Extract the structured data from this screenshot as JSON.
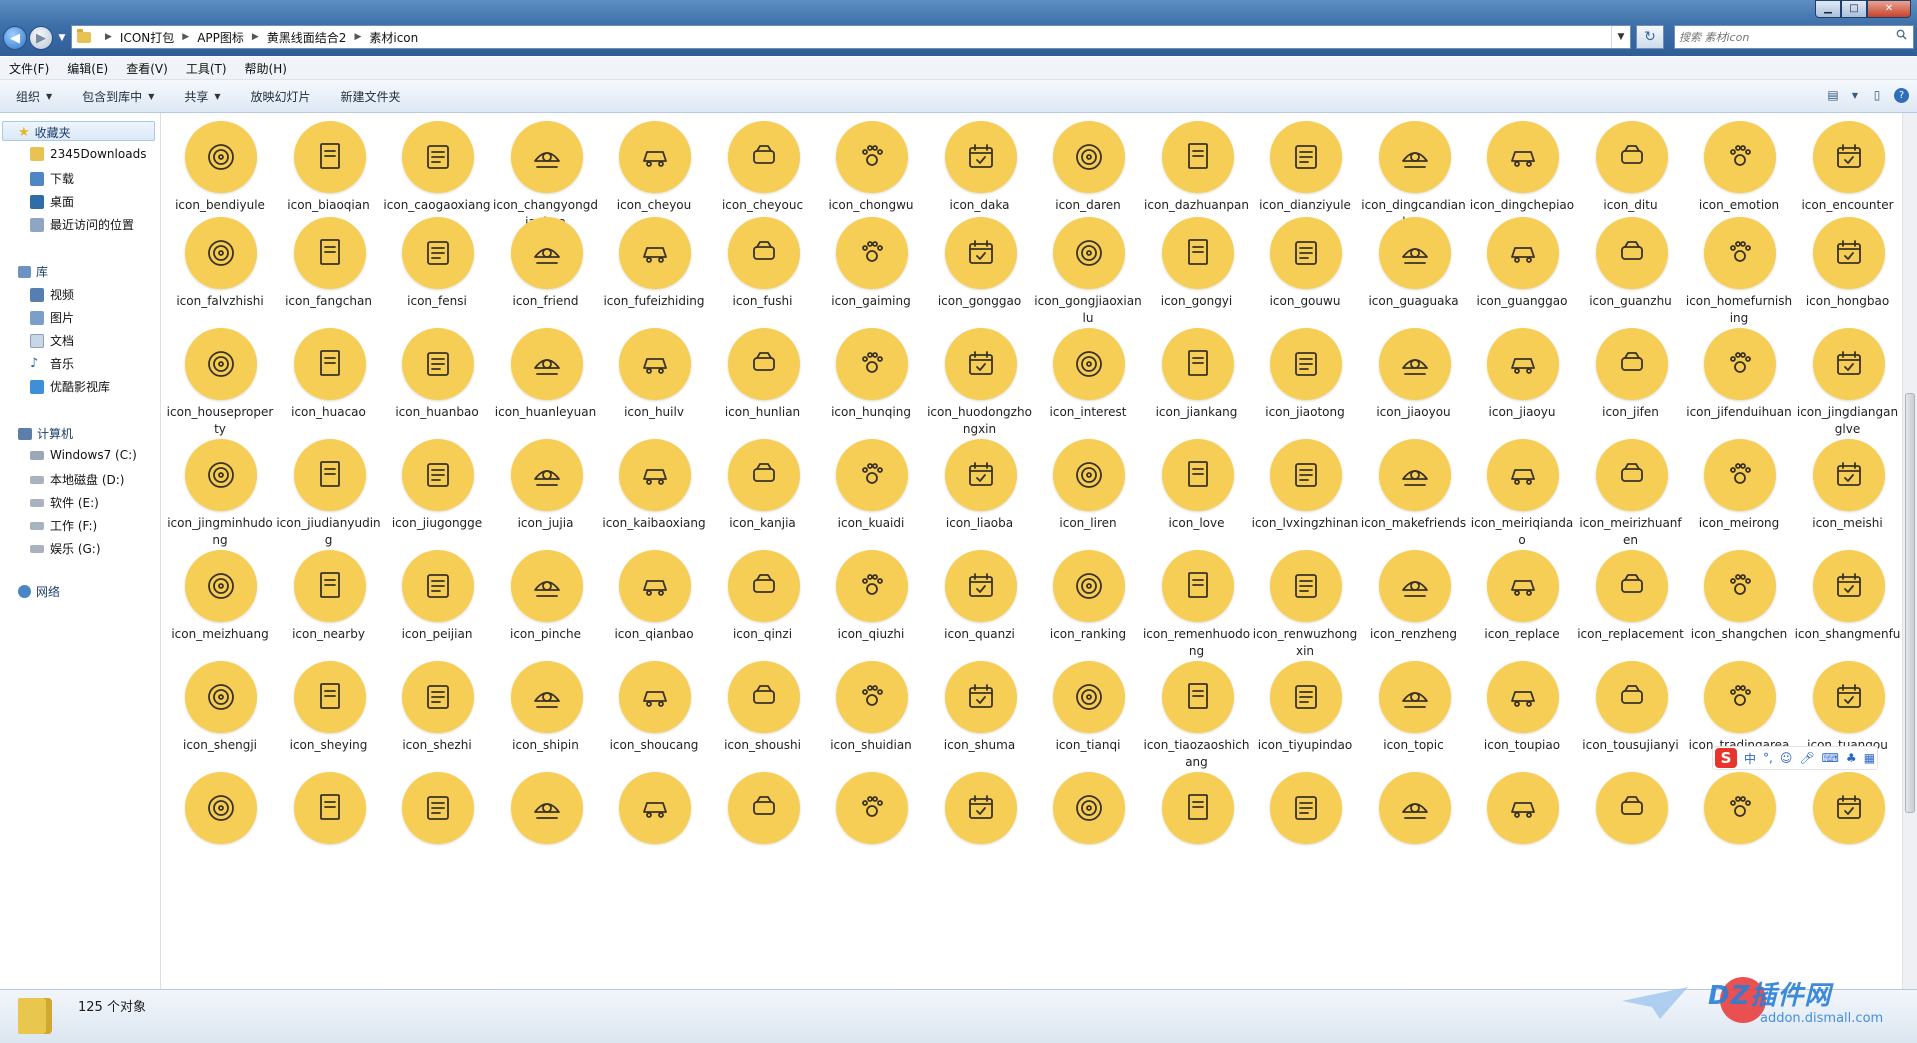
{
  "window": {
    "breadcrumb": [
      "ICON打包",
      "APP图标",
      "黄黑线面结合2",
      "素材icon"
    ],
    "search_placeholder": "搜索 素材icon"
  },
  "menu": [
    "文件(F)",
    "编辑(E)",
    "查看(V)",
    "工具(T)",
    "帮助(H)"
  ],
  "toolbar": [
    {
      "label": "组织",
      "dropdown": true
    },
    {
      "label": "包含到库中",
      "dropdown": true
    },
    {
      "label": "共享",
      "dropdown": true
    },
    {
      "label": "放映幻灯片",
      "dropdown": false
    },
    {
      "label": "新建文件夹",
      "dropdown": false
    }
  ],
  "sidebar": {
    "favorites": {
      "label": "收藏夹",
      "items": [
        "2345Downloads",
        "下载",
        "桌面",
        "最近访问的位置"
      ]
    },
    "libraries": {
      "label": "库",
      "items": [
        "视频",
        "图片",
        "文档",
        "音乐",
        "优酷影视库"
      ]
    },
    "computer": {
      "label": "计算机",
      "items": [
        "Windows7 (C:)",
        "本地磁盘 (D:)",
        "软件 (E:)",
        "工作 (F:)",
        "娱乐 (G:)"
      ]
    },
    "network": {
      "label": "网络"
    }
  },
  "files": [
    "icon_bendiyule",
    "icon_biaoqian",
    "icon_caogaoxiang",
    "icon_changyongdianhua",
    "icon_cheyou",
    "icon_cheyouc",
    "icon_chongwu",
    "icon_daka",
    "icon_daren",
    "icon_dazhuanpan",
    "icon_dianziyule",
    "icon_dingcandianhua",
    "icon_dingchepiao",
    "icon_ditu",
    "icon_emotion",
    "icon_encounter",
    "icon_falvzhishi",
    "icon_fangchan",
    "icon_fensi",
    "icon_friend",
    "icon_fufeizhiding",
    "icon_fushi",
    "icon_gaiming",
    "icon_gonggao",
    "icon_gongjiaoxianlu",
    "icon_gongyi",
    "icon_gouwu",
    "icon_guaguaka",
    "icon_guanggao",
    "icon_guanzhu",
    "icon_homefurnishing",
    "icon_hongbao",
    "icon_houseproperty",
    "icon_huacao",
    "icon_huanbao",
    "icon_huanleyuan",
    "icon_huilv",
    "icon_hunlian",
    "icon_hunqing",
    "icon_huodongzhongxin",
    "icon_interest",
    "icon_jiankang",
    "icon_jiaotong",
    "icon_jiaoyou",
    "icon_jiaoyu",
    "icon_jifen",
    "icon_jifenduihuan",
    "icon_jingdianganglve",
    "icon_jingminhudong",
    "icon_jiudianyuding",
    "icon_jiugongge",
    "icon_jujia",
    "icon_kaibaoxiang",
    "icon_kanjia",
    "icon_kuaidi",
    "icon_liaoba",
    "icon_liren",
    "icon_love",
    "icon_lvxingzhinan",
    "icon_makefriends",
    "icon_meiriqiandao",
    "icon_meirizhuanfen",
    "icon_meirong",
    "icon_meishi",
    "icon_meizhuang",
    "icon_nearby",
    "icon_peijian",
    "icon_pinche",
    "icon_qianbao",
    "icon_qinzi",
    "icon_qiuzhi",
    "icon_quanzi",
    "icon_ranking",
    "icon_remenhuodong",
    "icon_renwuzhongxin",
    "icon_renzheng",
    "icon_replace",
    "icon_replacement",
    "icon_shangchen",
    "icon_shangmenfu",
    "icon_shengji",
    "icon_sheying",
    "icon_shezhi",
    "icon_shipin",
    "icon_shoucang",
    "icon_shoushi",
    "icon_shuidian",
    "icon_shuma",
    "icon_tianqi",
    "icon_tiaozaoshichang",
    "icon_tiyupindao",
    "icon_topic",
    "icon_toupiao",
    "icon_tousujianyi",
    "icon_tradingarea",
    "icon_tuangou",
    "",
    "",
    "",
    "",
    "",
    "",
    "",
    "",
    "",
    "",
    "",
    "",
    "",
    "",
    "",
    ""
  ],
  "status": {
    "count_text": "125 个对象"
  },
  "ime": {
    "items": [
      "中",
      "°,"
    ]
  },
  "watermark": {
    "text": "DZ插件网",
    "url": "addon.dismall.com"
  },
  "colors": {
    "icon_circle": "#f6ce55",
    "icon_stroke": "#3a3226",
    "titlebar": "#3d6fa8"
  }
}
